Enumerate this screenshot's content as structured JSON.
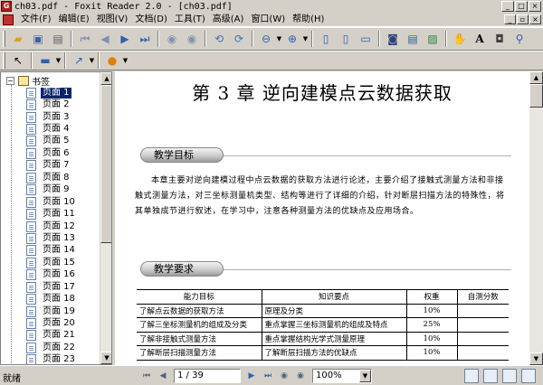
{
  "window": {
    "title": "ch03.pdf - Foxit Reader 2.0 - [ch03.pdf]"
  },
  "menu": [
    "文件(F)",
    "编辑(E)",
    "视图(V)",
    "文档(D)",
    "工具(T)",
    "高级(A)",
    "窗口(W)",
    "帮助(H)"
  ],
  "bookmarks": {
    "root_label": "书签",
    "pages": [
      "页面 1",
      "页面 2",
      "页面 3",
      "页面 4",
      "页面 5",
      "页面 6",
      "页面 7",
      "页面 8",
      "页面 9",
      "页面 10",
      "页面 11",
      "页面 12",
      "页面 13",
      "页面 14",
      "页面 15",
      "页面 16",
      "页面 17",
      "页面 18",
      "页面 19",
      "页面 20",
      "页面 21",
      "页面 22",
      "页面 23"
    ]
  },
  "document": {
    "chapter_title": "第 3 章    逆向建模点云数据获取",
    "section1": "教学目标",
    "body": "本章主要对逆向建模过程中点云数据的获取方法进行论述，主要介绍了接触式测量方法和非接触式测量方法，对三坐标测量机类型、结构等进行了详细的介绍，针对断层扫描方法的特殊性，将其单独成节进行叙述，在学习中，注意各种测量方法的优缺点及应用场合。",
    "section2": "教学要求",
    "table": {
      "headers": [
        "能力目标",
        "知识要点",
        "权重",
        "自测分数"
      ],
      "rows": [
        [
          "了解点云数据的获取方法",
          "原理及分类",
          "10%",
          ""
        ],
        [
          "了解三坐标测量机的组成及分类",
          "重点掌握三坐标测量机的组成及特点",
          "25%",
          ""
        ],
        [
          "了解非接触式测量方法",
          "重点掌握结构光学式测量原理",
          "10%",
          ""
        ],
        [
          "了解断层扫描测量方法",
          "了解断层扫描方法的优缺点",
          "10%",
          ""
        ]
      ]
    }
  },
  "status": {
    "text": "就绪",
    "page_indicator": "1 / 39",
    "zoom": "100%"
  },
  "colors": {
    "selection": "#0a246a",
    "chrome": "#d4d0c8"
  }
}
